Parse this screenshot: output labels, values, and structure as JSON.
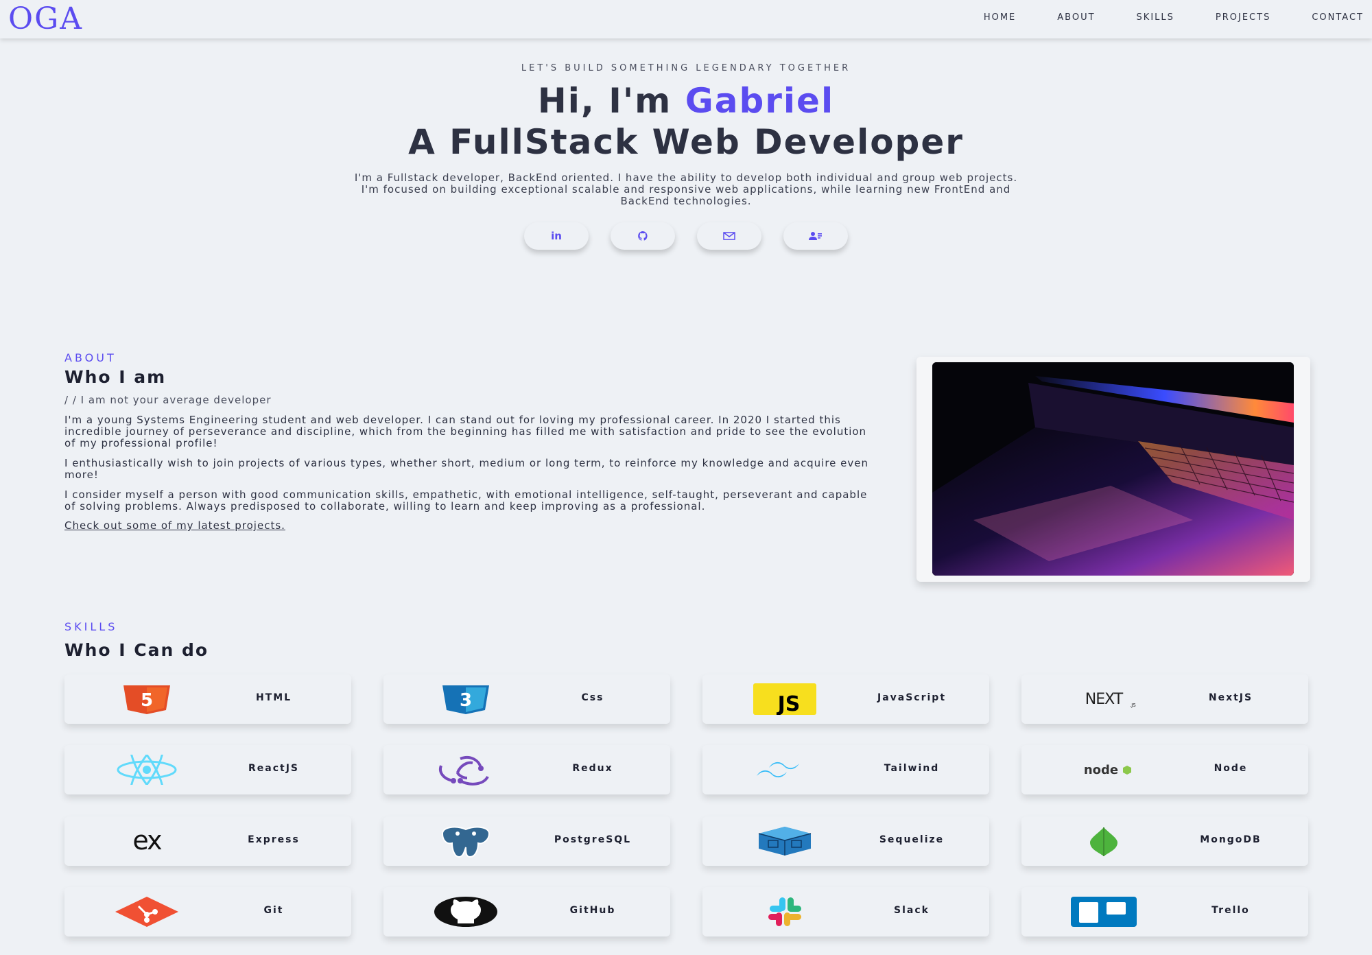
{
  "nav": {
    "logo": "OGA",
    "links": [
      "HOME",
      "ABOUT",
      "SKILLS",
      "PROJECTS",
      "CONTACT"
    ]
  },
  "hero": {
    "eyebrow": "LET'S BUILD SOMETHING LEGENDARY TOGETHER",
    "greeting": "Hi, I'm ",
    "name": "Gabriel",
    "role": "A FullStack Web Developer",
    "description_lines": [
      "I'm a Fullstack developer, BackEnd oriented. I have the ability to develop both individual and group web projects.",
      "I'm focused on building exceptional scalable and responsive web applications, while learning new FrontEnd and",
      "BackEnd technologies."
    ],
    "socials": [
      {
        "icon": "linkedin-icon",
        "glyph": "in"
      },
      {
        "icon": "github-icon",
        "glyph": ""
      },
      {
        "icon": "mail-icon",
        "glyph": ""
      },
      {
        "icon": "contact-card-icon",
        "glyph": ""
      }
    ]
  },
  "about": {
    "kicker": "ABOUT",
    "title": "Who I am",
    "quote": "/ / I am not your average developer",
    "paragraphs": [
      "I'm a young Systems Engineering student and web developer. I can stand out for loving my professional career. In 2020 I started this incredible journey of perseverance and discipline, which from the beginning has filled me with satisfaction and pride to see the evolution of my professional profile!",
      "I enthusiastically wish to join projects of various types, whether short, medium or long term, to reinforce my knowledge and acquire even more!",
      "I consider myself a person with good communication skills, empathetic, with emotional intelligence, self-taught, perseverant and capable of solving problems. Always predisposed to collaborate, willing to learn and keep improving as a professional."
    ],
    "link": "Check out some of my latest projects."
  },
  "skills": {
    "kicker": "SKILLS",
    "title": "Who I Can do",
    "items": [
      {
        "label": "HTML",
        "icon": "html5-icon"
      },
      {
        "label": "Css",
        "icon": "css3-icon"
      },
      {
        "label": "JavaScript",
        "icon": "javascript-icon"
      },
      {
        "label": "NextJS",
        "icon": "nextjs-icon"
      },
      {
        "label": "ReactJS",
        "icon": "react-icon"
      },
      {
        "label": "Redux",
        "icon": "redux-icon"
      },
      {
        "label": "Tailwind",
        "icon": "tailwind-icon"
      },
      {
        "label": "Node",
        "icon": "node-icon"
      },
      {
        "label": "Express",
        "icon": "express-icon"
      },
      {
        "label": "PostgreSQL",
        "icon": "postgresql-icon"
      },
      {
        "label": "Sequelize",
        "icon": "sequelize-icon"
      },
      {
        "label": "MongoDB",
        "icon": "mongodb-icon"
      },
      {
        "label": "Git",
        "icon": "git-icon"
      },
      {
        "label": "GitHub",
        "icon": "github-icon"
      },
      {
        "label": "Slack",
        "icon": "slack-icon"
      },
      {
        "label": "Trello",
        "icon": "trello-icon"
      }
    ]
  },
  "colors": {
    "accent": "#5b4cf0",
    "background": "#eef1f5",
    "text": "#2d3142"
  }
}
